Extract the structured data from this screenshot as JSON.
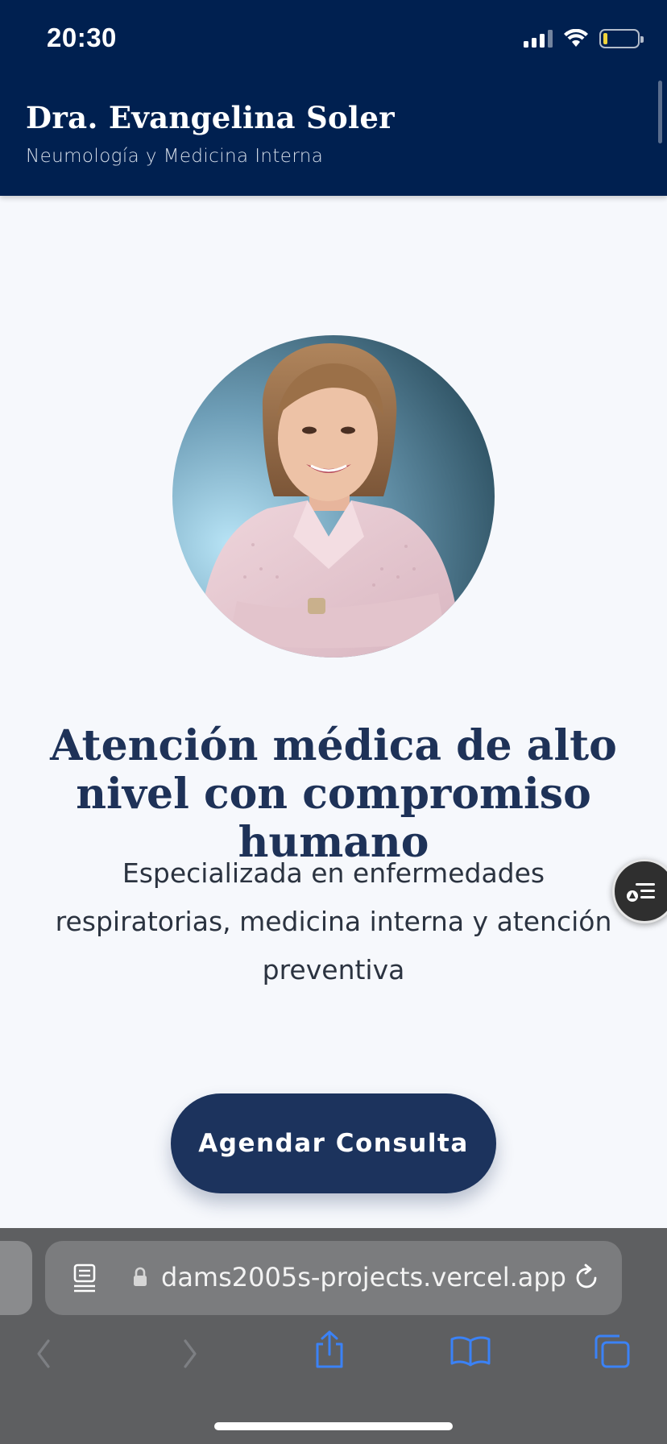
{
  "status_bar": {
    "time": "20:30"
  },
  "header": {
    "doctor_name": "Dra. Evangelina Soler",
    "specialty": "Neumología y Medicina Interna"
  },
  "hero": {
    "headline": "Atención médica de alto nivel con compromiso humano",
    "subtext": "Especializada en enfermedades respiratorias, medicina interna y atención preventiva",
    "cta_label": "Agendar Consulta"
  },
  "browser": {
    "url": "dams2005s-projects.vercel.app",
    "icons": [
      "reader-icon",
      "lock-icon",
      "reload-icon",
      "back-icon",
      "forward-icon",
      "share-icon",
      "bookmarks-icon",
      "tabs-icon"
    ]
  },
  "colors": {
    "header_bg": "#002050",
    "headline": "#1e3258",
    "cta_bg": "#1c335d",
    "page_bg": "#f6f8fc",
    "browser_bg": "#5e5f61",
    "safari_blue": "#3b82f6"
  }
}
